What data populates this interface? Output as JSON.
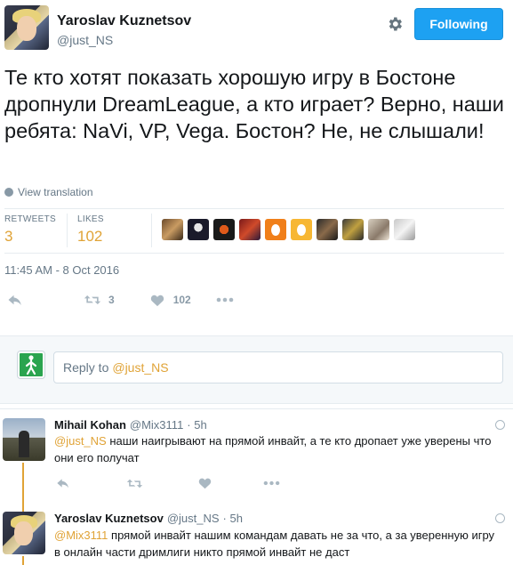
{
  "tweet": {
    "author_name": "Yaroslav Kuznetsov",
    "author_handle": "@just_NS",
    "follow_label": "Following",
    "text": "Те кто хотят показать хорошую игру в Бостоне дропнули DreamLeague, а кто играет? Верно, наши ребята: NaVi, VP, Vega. Бостон? Не, не слышали!",
    "view_translation": "View translation",
    "retweets_label": "RETWEETS",
    "retweets_count": "3",
    "likes_label": "LIKES",
    "likes_count": "102",
    "timestamp": "11:45 AM - 8 Oct 2016",
    "action_retweet_count": "3",
    "action_like_count": "102"
  },
  "reply_composer": {
    "prefix": "Reply to",
    "mention": "@just_NS"
  },
  "replies": [
    {
      "name": "Mihail Kohan",
      "handle": "@Mix3111",
      "time": "· 5h",
      "mention": "@just_NS",
      "text": "наши наигрывают на прямой инвайт, а те кто дропает уже уверены что они его получат"
    },
    {
      "name": "Yaroslav Kuznetsov",
      "handle": "@just_NS",
      "time": "· 5h",
      "mention": "@Mix3111",
      "text": "прямой инвайт нашим командам давать не за что, а за уверенную игру в онлайн части дримлиги никто прямой инвайт не даст"
    }
  ],
  "colors": {
    "accent": "#e0a336",
    "follow_button": "#1da1f2",
    "muted": "#657786"
  }
}
